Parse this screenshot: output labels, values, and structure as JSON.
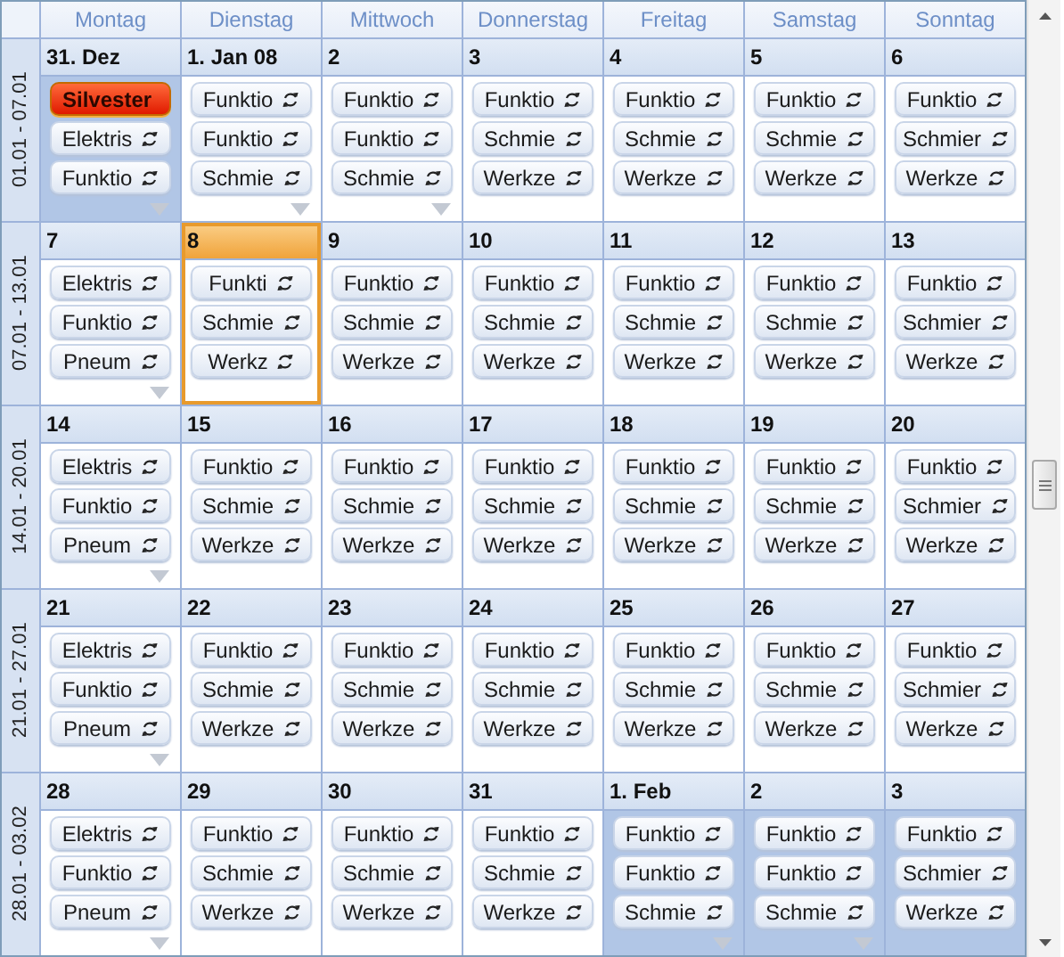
{
  "weekdays": [
    "Montag",
    "Dienstag",
    "Mittwoch",
    "Donnerstag",
    "Freitag",
    "Samstag",
    "Sonntag"
  ],
  "weeks": [
    {
      "label": "01.01 - 07.01",
      "days": [
        {
          "date": "31. Dez",
          "today": false,
          "outside_month": true,
          "more": true,
          "events": [
            {
              "title": "Silvester",
              "kind": "holiday"
            },
            {
              "title": "Elektris",
              "kind": "recurring"
            },
            {
              "title": "Funktio",
              "kind": "recurring"
            }
          ]
        },
        {
          "date": "1. Jan 08",
          "today": false,
          "outside_month": false,
          "more": true,
          "events": [
            {
              "title": "Funktio",
              "kind": "recurring"
            },
            {
              "title": "Funktio",
              "kind": "recurring"
            },
            {
              "title": "Schmie",
              "kind": "recurring"
            }
          ]
        },
        {
          "date": "2",
          "today": false,
          "outside_month": false,
          "more": true,
          "events": [
            {
              "title": "Funktio",
              "kind": "recurring"
            },
            {
              "title": "Funktio",
              "kind": "recurring"
            },
            {
              "title": "Schmie",
              "kind": "recurring"
            }
          ]
        },
        {
          "date": "3",
          "today": false,
          "outside_month": false,
          "more": false,
          "events": [
            {
              "title": "Funktio",
              "kind": "recurring"
            },
            {
              "title": "Schmie",
              "kind": "recurring"
            },
            {
              "title": "Werkze",
              "kind": "recurring"
            }
          ]
        },
        {
          "date": "4",
          "today": false,
          "outside_month": false,
          "more": false,
          "events": [
            {
              "title": "Funktio",
              "kind": "recurring"
            },
            {
              "title": "Schmie",
              "kind": "recurring"
            },
            {
              "title": "Werkze",
              "kind": "recurring"
            }
          ]
        },
        {
          "date": "5",
          "today": false,
          "outside_month": false,
          "more": false,
          "events": [
            {
              "title": "Funktio",
              "kind": "recurring"
            },
            {
              "title": "Schmie",
              "kind": "recurring"
            },
            {
              "title": "Werkze",
              "kind": "recurring"
            }
          ]
        },
        {
          "date": "6",
          "today": false,
          "outside_month": false,
          "more": false,
          "events": [
            {
              "title": "Funktio",
              "kind": "recurring"
            },
            {
              "title": "Schmier",
              "kind": "recurring"
            },
            {
              "title": "Werkze",
              "kind": "recurring"
            }
          ]
        }
      ]
    },
    {
      "label": "07.01 - 13.01",
      "days": [
        {
          "date": "7",
          "today": false,
          "outside_month": false,
          "more": true,
          "events": [
            {
              "title": "Elektris",
              "kind": "recurring"
            },
            {
              "title": "Funktio",
              "kind": "recurring"
            },
            {
              "title": "Pneum",
              "kind": "recurring"
            }
          ]
        },
        {
          "date": "8",
          "today": true,
          "outside_month": false,
          "more": false,
          "events": [
            {
              "title": "Funkti",
              "kind": "recurring"
            },
            {
              "title": "Schmie",
              "kind": "recurring"
            },
            {
              "title": "Werkz",
              "kind": "recurring"
            }
          ]
        },
        {
          "date": "9",
          "today": false,
          "outside_month": false,
          "more": false,
          "events": [
            {
              "title": "Funktio",
              "kind": "recurring"
            },
            {
              "title": "Schmie",
              "kind": "recurring"
            },
            {
              "title": "Werkze",
              "kind": "recurring"
            }
          ]
        },
        {
          "date": "10",
          "today": false,
          "outside_month": false,
          "more": false,
          "events": [
            {
              "title": "Funktio",
              "kind": "recurring"
            },
            {
              "title": "Schmie",
              "kind": "recurring"
            },
            {
              "title": "Werkze",
              "kind": "recurring"
            }
          ]
        },
        {
          "date": "11",
          "today": false,
          "outside_month": false,
          "more": false,
          "events": [
            {
              "title": "Funktio",
              "kind": "recurring"
            },
            {
              "title": "Schmie",
              "kind": "recurring"
            },
            {
              "title": "Werkze",
              "kind": "recurring"
            }
          ]
        },
        {
          "date": "12",
          "today": false,
          "outside_month": false,
          "more": false,
          "events": [
            {
              "title": "Funktio",
              "kind": "recurring"
            },
            {
              "title": "Schmie",
              "kind": "recurring"
            },
            {
              "title": "Werkze",
              "kind": "recurring"
            }
          ]
        },
        {
          "date": "13",
          "today": false,
          "outside_month": false,
          "more": false,
          "events": [
            {
              "title": "Funktio",
              "kind": "recurring"
            },
            {
              "title": "Schmier",
              "kind": "recurring"
            },
            {
              "title": "Werkze",
              "kind": "recurring"
            }
          ]
        }
      ]
    },
    {
      "label": "14.01 - 20.01",
      "days": [
        {
          "date": "14",
          "today": false,
          "outside_month": false,
          "more": true,
          "events": [
            {
              "title": "Elektris",
              "kind": "recurring"
            },
            {
              "title": "Funktio",
              "kind": "recurring"
            },
            {
              "title": "Pneum",
              "kind": "recurring"
            }
          ]
        },
        {
          "date": "15",
          "today": false,
          "outside_month": false,
          "more": false,
          "events": [
            {
              "title": "Funktio",
              "kind": "recurring"
            },
            {
              "title": "Schmie",
              "kind": "recurring"
            },
            {
              "title": "Werkze",
              "kind": "recurring"
            }
          ]
        },
        {
          "date": "16",
          "today": false,
          "outside_month": false,
          "more": false,
          "events": [
            {
              "title": "Funktio",
              "kind": "recurring"
            },
            {
              "title": "Schmie",
              "kind": "recurring"
            },
            {
              "title": "Werkze",
              "kind": "recurring"
            }
          ]
        },
        {
          "date": "17",
          "today": false,
          "outside_month": false,
          "more": false,
          "events": [
            {
              "title": "Funktio",
              "kind": "recurring"
            },
            {
              "title": "Schmie",
              "kind": "recurring"
            },
            {
              "title": "Werkze",
              "kind": "recurring"
            }
          ]
        },
        {
          "date": "18",
          "today": false,
          "outside_month": false,
          "more": false,
          "events": [
            {
              "title": "Funktio",
              "kind": "recurring"
            },
            {
              "title": "Schmie",
              "kind": "recurring"
            },
            {
              "title": "Werkze",
              "kind": "recurring"
            }
          ]
        },
        {
          "date": "19",
          "today": false,
          "outside_month": false,
          "more": false,
          "events": [
            {
              "title": "Funktio",
              "kind": "recurring"
            },
            {
              "title": "Schmie",
              "kind": "recurring"
            },
            {
              "title": "Werkze",
              "kind": "recurring"
            }
          ]
        },
        {
          "date": "20",
          "today": false,
          "outside_month": false,
          "more": false,
          "events": [
            {
              "title": "Funktio",
              "kind": "recurring"
            },
            {
              "title": "Schmier",
              "kind": "recurring"
            },
            {
              "title": "Werkze",
              "kind": "recurring"
            }
          ]
        }
      ]
    },
    {
      "label": "21.01 - 27.01",
      "days": [
        {
          "date": "21",
          "today": false,
          "outside_month": false,
          "more": true,
          "events": [
            {
              "title": "Elektris",
              "kind": "recurring"
            },
            {
              "title": "Funktio",
              "kind": "recurring"
            },
            {
              "title": "Pneum",
              "kind": "recurring"
            }
          ]
        },
        {
          "date": "22",
          "today": false,
          "outside_month": false,
          "more": false,
          "events": [
            {
              "title": "Funktio",
              "kind": "recurring"
            },
            {
              "title": "Schmie",
              "kind": "recurring"
            },
            {
              "title": "Werkze",
              "kind": "recurring"
            }
          ]
        },
        {
          "date": "23",
          "today": false,
          "outside_month": false,
          "more": false,
          "events": [
            {
              "title": "Funktio",
              "kind": "recurring"
            },
            {
              "title": "Schmie",
              "kind": "recurring"
            },
            {
              "title": "Werkze",
              "kind": "recurring"
            }
          ]
        },
        {
          "date": "24",
          "today": false,
          "outside_month": false,
          "more": false,
          "events": [
            {
              "title": "Funktio",
              "kind": "recurring"
            },
            {
              "title": "Schmie",
              "kind": "recurring"
            },
            {
              "title": "Werkze",
              "kind": "recurring"
            }
          ]
        },
        {
          "date": "25",
          "today": false,
          "outside_month": false,
          "more": false,
          "events": [
            {
              "title": "Funktio",
              "kind": "recurring"
            },
            {
              "title": "Schmie",
              "kind": "recurring"
            },
            {
              "title": "Werkze",
              "kind": "recurring"
            }
          ]
        },
        {
          "date": "26",
          "today": false,
          "outside_month": false,
          "more": false,
          "events": [
            {
              "title": "Funktio",
              "kind": "recurring"
            },
            {
              "title": "Schmie",
              "kind": "recurring"
            },
            {
              "title": "Werkze",
              "kind": "recurring"
            }
          ]
        },
        {
          "date": "27",
          "today": false,
          "outside_month": false,
          "more": false,
          "events": [
            {
              "title": "Funktio",
              "kind": "recurring"
            },
            {
              "title": "Schmier",
              "kind": "recurring"
            },
            {
              "title": "Werkze",
              "kind": "recurring"
            }
          ]
        }
      ]
    },
    {
      "label": "28.01 - 03.02",
      "days": [
        {
          "date": "28",
          "today": false,
          "outside_month": false,
          "more": true,
          "events": [
            {
              "title": "Elektris",
              "kind": "recurring"
            },
            {
              "title": "Funktio",
              "kind": "recurring"
            },
            {
              "title": "Pneum",
              "kind": "recurring"
            }
          ]
        },
        {
          "date": "29",
          "today": false,
          "outside_month": false,
          "more": false,
          "events": [
            {
              "title": "Funktio",
              "kind": "recurring"
            },
            {
              "title": "Schmie",
              "kind": "recurring"
            },
            {
              "title": "Werkze",
              "kind": "recurring"
            }
          ]
        },
        {
          "date": "30",
          "today": false,
          "outside_month": false,
          "more": false,
          "events": [
            {
              "title": "Funktio",
              "kind": "recurring"
            },
            {
              "title": "Schmie",
              "kind": "recurring"
            },
            {
              "title": "Werkze",
              "kind": "recurring"
            }
          ]
        },
        {
          "date": "31",
          "today": false,
          "outside_month": false,
          "more": false,
          "events": [
            {
              "title": "Funktio",
              "kind": "recurring"
            },
            {
              "title": "Schmie",
              "kind": "recurring"
            },
            {
              "title": "Werkze",
              "kind": "recurring"
            }
          ]
        },
        {
          "date": "1. Feb",
          "today": false,
          "outside_month": true,
          "more": true,
          "events": [
            {
              "title": "Funktio",
              "kind": "recurring"
            },
            {
              "title": "Funktio",
              "kind": "recurring"
            },
            {
              "title": "Schmie",
              "kind": "recurring"
            }
          ]
        },
        {
          "date": "2",
          "today": false,
          "outside_month": true,
          "more": true,
          "events": [
            {
              "title": "Funktio",
              "kind": "recurring"
            },
            {
              "title": "Funktio",
              "kind": "recurring"
            },
            {
              "title": "Schmie",
              "kind": "recurring"
            }
          ]
        },
        {
          "date": "3",
          "today": false,
          "outside_month": true,
          "more": false,
          "events": [
            {
              "title": "Funktio",
              "kind": "recurring"
            },
            {
              "title": "Schmier",
              "kind": "recurring"
            },
            {
              "title": "Werkze",
              "kind": "recurring"
            }
          ]
        }
      ]
    }
  ]
}
